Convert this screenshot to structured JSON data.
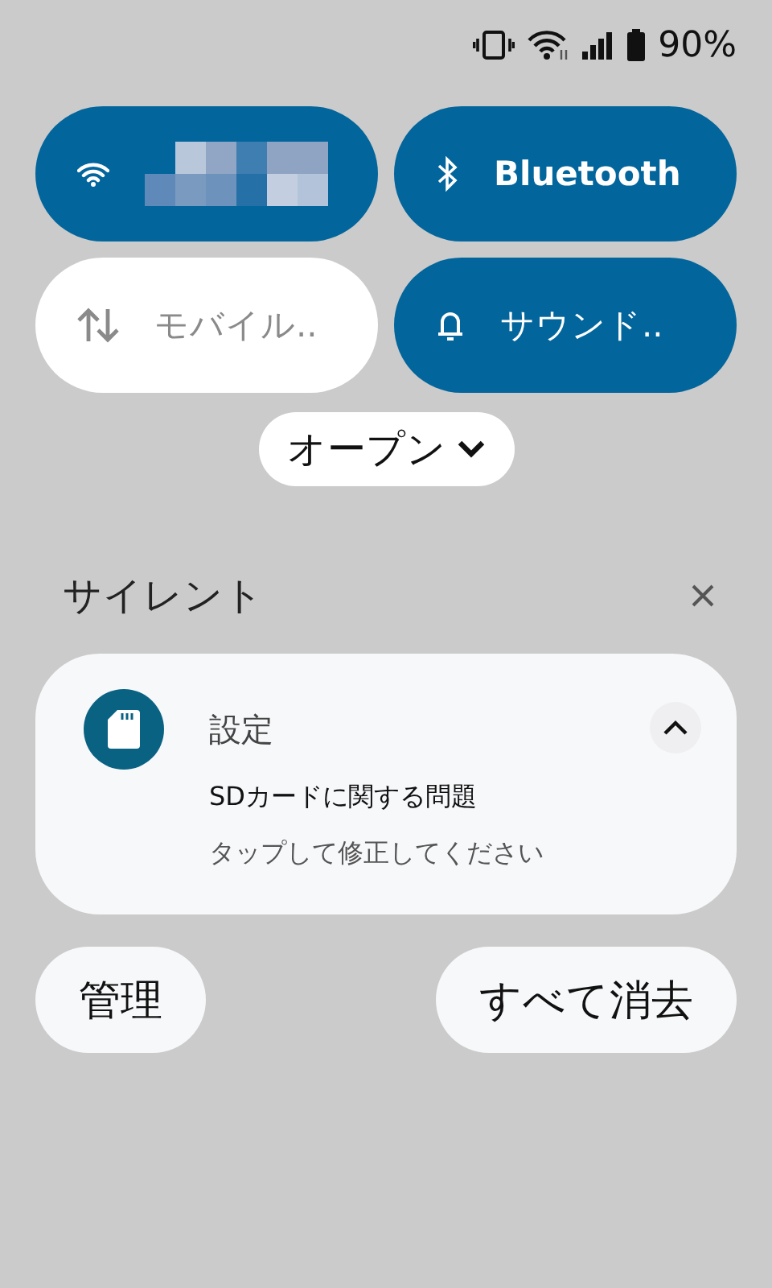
{
  "status_bar": {
    "battery": "90%"
  },
  "tiles": [
    {
      "kind": "wifi",
      "on": true
    },
    {
      "kind": "bluetooth",
      "label": "Bluetooth",
      "on": true
    },
    {
      "kind": "mobile",
      "label": "モバイル..",
      "on": false
    },
    {
      "kind": "sound",
      "label": "サウンド..",
      "on": true
    }
  ],
  "open_button": {
    "label": "オープン"
  },
  "section": {
    "title": "サイレント"
  },
  "notification": {
    "app": "設定",
    "title": "SDカードに関する問題",
    "text": "タップして修正してください",
    "expanded": true
  },
  "buttons": [
    {
      "label": "管理"
    },
    {
      "label": "すべて消去"
    }
  ]
}
